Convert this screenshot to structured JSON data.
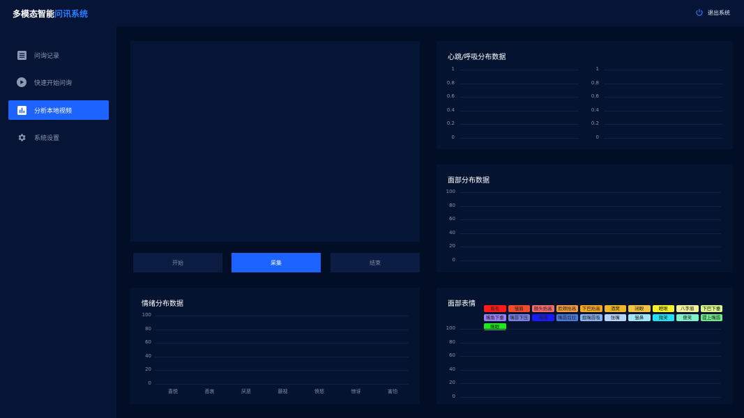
{
  "header": {
    "title_main": "多模态智能",
    "title_accent": "问讯系统",
    "logout_label": "退出系统"
  },
  "sidebar": {
    "items": [
      {
        "label": "问询记录",
        "icon": "list-icon",
        "active": false
      },
      {
        "label": "快速开始问询",
        "icon": "play-icon",
        "active": false
      },
      {
        "label": "分析本地视频",
        "icon": "bar-chart-icon",
        "active": true
      },
      {
        "label": "系统设置",
        "icon": "gear-icon",
        "active": false
      }
    ]
  },
  "controls": {
    "start_label": "开始",
    "capture_label": "采集",
    "end_label": "结束"
  },
  "heart": {
    "title": "心跳/呼吸分布数据",
    "ticks_left": [
      "1",
      "0.8",
      "0.6",
      "0.4",
      "0.2",
      "0"
    ],
    "ticks_right": [
      "1",
      "0.8",
      "0.6",
      "0.4",
      "0.2",
      "0"
    ]
  },
  "face_dist": {
    "title": "面部分布数据",
    "ticks": [
      "100",
      "80",
      "60",
      "40",
      "20",
      "0"
    ]
  },
  "emotion": {
    "title": "情绪分布数据",
    "ticks": [
      "100",
      "80",
      "60",
      "40",
      "20",
      "0"
    ],
    "categories": [
      "喜悦",
      "悲哀",
      "厌恶",
      "藐视",
      "愤怒",
      "惊讶",
      "害怕"
    ]
  },
  "expression": {
    "title": "面部表情",
    "ticks": [
      "100",
      "80",
      "60",
      "40",
      "20",
      "0"
    ],
    "legend": [
      {
        "label": "眉毛",
        "color": "#ff1a1a"
      },
      {
        "label": "皱眉",
        "color": "#f24b2a"
      },
      {
        "label": "额头抬高",
        "color": "#f56a6a"
      },
      {
        "label": "脸颊抬高",
        "color": "#f59b3b"
      },
      {
        "label": "下巴抬高",
        "color": "#f5a623"
      },
      {
        "label": "酒窝",
        "color": "#f0b429"
      },
      {
        "label": "闭眼",
        "color": "#f5c343"
      },
      {
        "label": "瞪眼",
        "color": "#f5f22b"
      },
      {
        "label": "八字眉",
        "color": "#f2f09a"
      },
      {
        "label": "下巴下垂",
        "color": "#d9f589"
      },
      {
        "label": "嘴角下垂",
        "color": "#9a7ff0"
      },
      {
        "label": "嘴唇下压",
        "color": "#7a7fe6"
      },
      {
        "label": "嘟嘴",
        "color": "#1a1aff"
      },
      {
        "label": "嘴唇后拉",
        "color": "#4a7bdc"
      },
      {
        "label": "抿嘴唇吸",
        "color": "#8ab4f0"
      },
      {
        "label": "张嘴",
        "color": "#b6d4f5"
      },
      {
        "label": "皱鼻",
        "color": "#9fe7f5"
      },
      {
        "label": "微笑",
        "color": "#22e0f0"
      },
      {
        "label": "傻笑",
        "color": "#7ff0c8"
      },
      {
        "label": "提上嘴唇",
        "color": "#6fe88a"
      },
      {
        "label": "眯眼",
        "color": "#22e622"
      }
    ]
  },
  "colors": {
    "accent": "#1d63ff",
    "background": "#020d26"
  }
}
